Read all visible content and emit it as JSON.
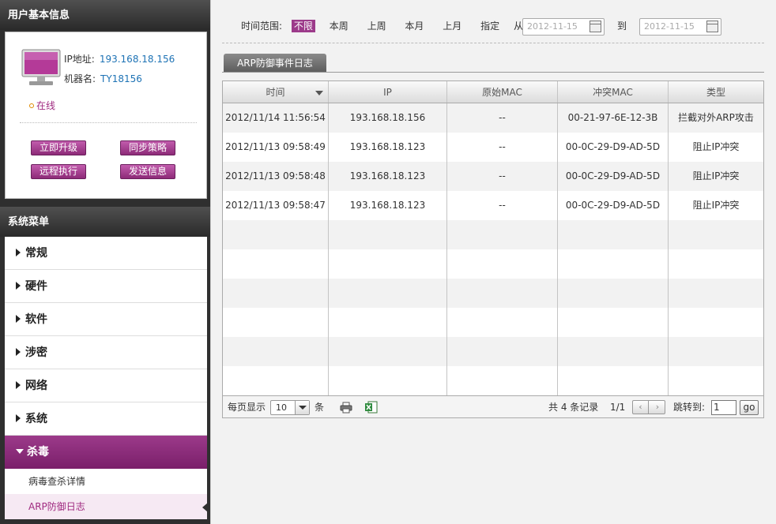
{
  "user_panel": {
    "title": "用户基本信息",
    "ip_label": "IP地址:",
    "ip_value": "193.168.18.156",
    "host_label": "机器名:",
    "host_value": "TY18156",
    "status": "在线",
    "buttons": [
      "立即升级",
      "同步策略",
      "远程执行",
      "发送信息"
    ]
  },
  "menu": {
    "title": "系统菜单",
    "items": [
      "常规",
      "硬件",
      "软件",
      "涉密",
      "网络",
      "系统"
    ],
    "active": "杀毒",
    "sub_items": [
      "病毒查杀详情",
      "ARP防御日志"
    ]
  },
  "filter": {
    "label": "时间范围:",
    "options": [
      "不限",
      "本周",
      "上周",
      "本月",
      "上月",
      "指定"
    ],
    "from_label": "从",
    "from_date": "2012-11-15",
    "to_label": "到",
    "to_date": "2012-11-15"
  },
  "tab": {
    "label": "ARP防御事件日志"
  },
  "table": {
    "columns": [
      "时间",
      "IP",
      "原始MAC",
      "冲突MAC",
      "类型"
    ],
    "rows": [
      [
        "2012/11/14 11:56:54",
        "193.168.18.156",
        "--",
        "00-21-97-6E-12-3B",
        "拦截对外ARP攻击"
      ],
      [
        "2012/11/13 09:58:49",
        "193.168.18.123",
        "--",
        "00-0C-29-D9-AD-5D",
        "阻止IP冲突"
      ],
      [
        "2012/11/13 09:58:48",
        "193.168.18.123",
        "--",
        "00-0C-29-D9-AD-5D",
        "阻止IP冲突"
      ],
      [
        "2012/11/13 09:58:47",
        "193.168.18.123",
        "--",
        "00-0C-29-D9-AD-5D",
        "阻止IP冲突"
      ]
    ]
  },
  "footer": {
    "per_page_label": "每页显示",
    "per_page_value": "10",
    "per_page_unit": "条",
    "total_text": "共 4 条记录",
    "page_text": "1/1",
    "jump_label": "跳转到:",
    "jump_value": "1",
    "go_label": "go"
  }
}
